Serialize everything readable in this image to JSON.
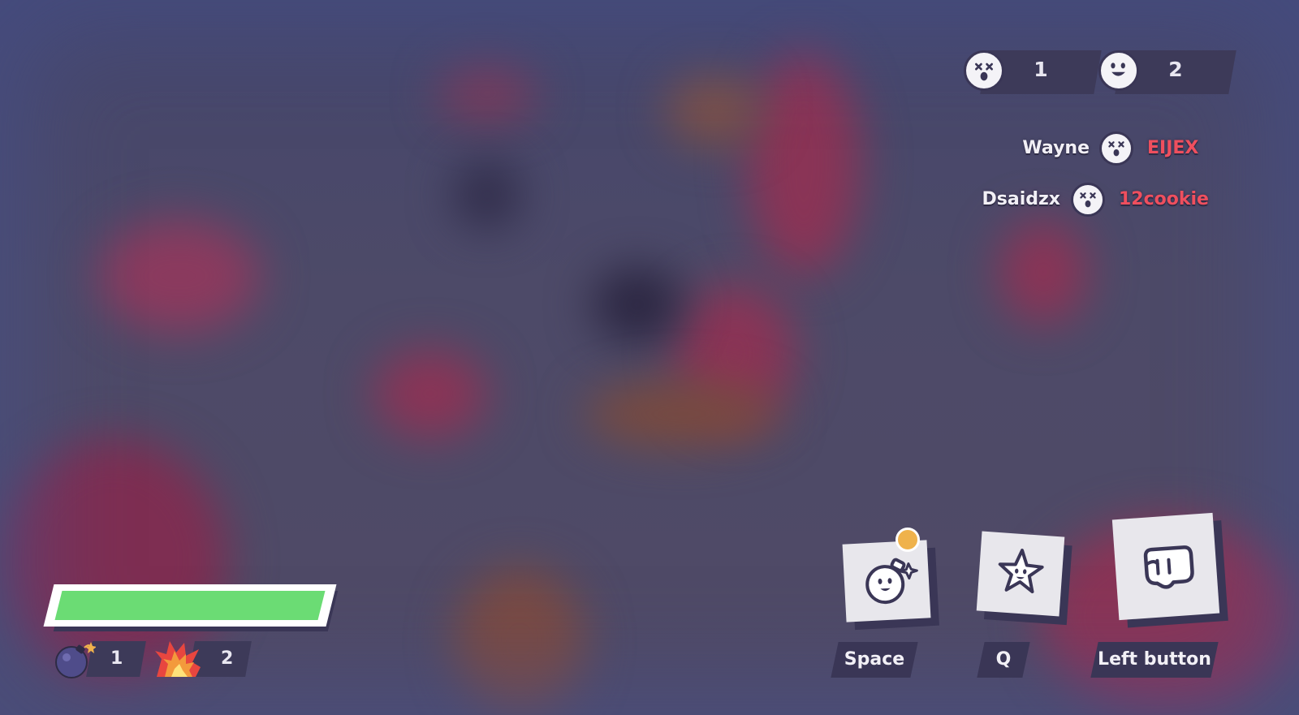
{
  "scoreboard": {
    "team_a": {
      "icon": "dead-face-icon",
      "score": "1"
    },
    "team_b": {
      "icon": "happy-face-icon",
      "score": "2"
    }
  },
  "killfeed": [
    {
      "killer": "Wayne",
      "icon": "dead-face-icon",
      "victim": "EIJEX"
    },
    {
      "killer": "Dsaidzx",
      "icon": "dead-face-icon",
      "victim": "12cookie"
    }
  ],
  "player": {
    "health_fraction": 1.0,
    "health_color": "#6bdc74",
    "bombs": {
      "icon": "bomb-icon",
      "count": "1"
    },
    "blast": {
      "icon": "explosion-icon",
      "count": "2"
    }
  },
  "abilities": [
    {
      "icon": "bomb-face-icon",
      "key": "Space",
      "ready_indicator": true,
      "indicator_color": "#efb24c"
    },
    {
      "icon": "star-icon",
      "key": "Q"
    },
    {
      "icon": "fist-icon",
      "key": "Left button"
    }
  ],
  "colors": {
    "accent_red": "#ef4f5e",
    "panel": "#3a3656"
  }
}
